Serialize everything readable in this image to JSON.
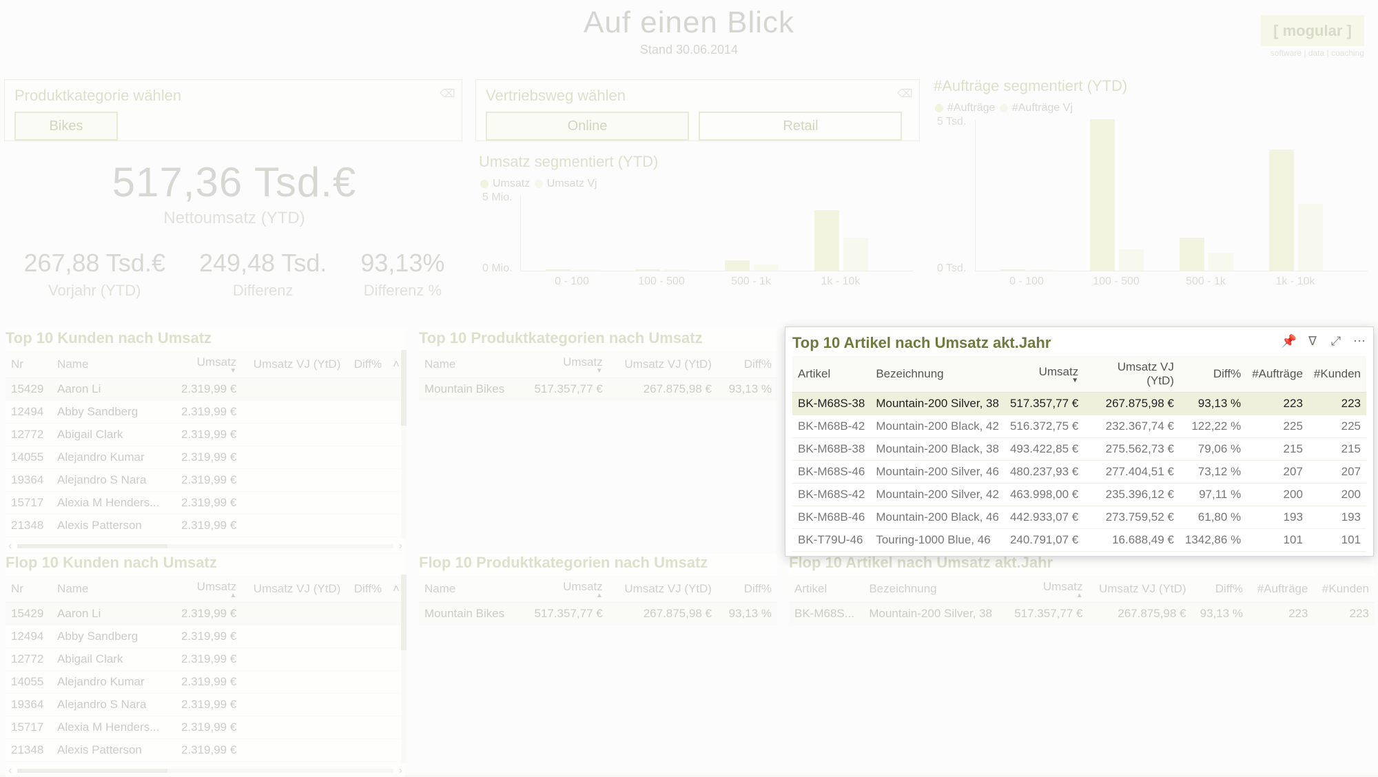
{
  "header": {
    "title": "Auf einen Blick",
    "subtitle": "Stand 30.06.2014"
  },
  "logo": {
    "text": "[ mogular ]",
    "sub": "software | data | coaching"
  },
  "slicer_category": {
    "title": "Produktkategorie wählen",
    "option": "Bikes"
  },
  "slicer_channel": {
    "title": "Vertriebsweg wählen",
    "option1": "Online",
    "option2": "Retail"
  },
  "kpi": {
    "main_value": "517,36 Tsd.€",
    "main_label": "Nettoumsatz (YTD)",
    "prev_value": "267,88 Tsd.€",
    "prev_label": "Vorjahr (YTD)",
    "diff_value": "249,48 Tsd.",
    "diff_label": "Differenz",
    "diffp_value": "93,13%",
    "diffp_label": "Differenz %"
  },
  "chart_umsatz": {
    "title": "Umsatz segmentiert (YTD)",
    "legend1": "Umsatz",
    "legend2": "Umsatz Vj",
    "ylab_top": "5 Mio.",
    "ylab_bot": "0 Mio."
  },
  "chart_auftraege": {
    "title": "#Aufträge segmentiert (YTD)",
    "legend1": "#Aufträge",
    "legend2": "#Aufträge Vj",
    "ylab_top": "5 Tsd.",
    "ylab_bot": "0 Tsd."
  },
  "chart_categories": {
    "c1": "0 - 100",
    "c2": "100 - 500",
    "c3": "500 - 1k",
    "c4": "1k - 10k"
  },
  "chart_data": [
    {
      "type": "bar",
      "title": "Umsatz segmentiert (YTD)",
      "categories": [
        "0 - 100",
        "100 - 500",
        "500 - 1k",
        "1k - 10k"
      ],
      "series": [
        {
          "name": "Umsatz",
          "values": [
            0.05,
            0.05,
            0.7,
            4.0
          ]
        },
        {
          "name": "Umsatz Vj",
          "values": [
            0.05,
            0.05,
            0.4,
            2.2
          ]
        }
      ],
      "ylabel": "Mio.",
      "ylim": [
        0,
        5
      ]
    },
    {
      "type": "bar",
      "title": "#Aufträge segmentiert (YTD)",
      "categories": [
        "0 - 100",
        "100 - 500",
        "500 - 1k",
        "1k - 10k"
      ],
      "series": [
        {
          "name": "#Aufträge",
          "values": [
            0.05,
            5.0,
            1.1,
            4.0
          ]
        },
        {
          "name": "#Aufträge Vj",
          "values": [
            0.05,
            0.7,
            0.6,
            2.2
          ]
        }
      ],
      "ylabel": "Tsd.",
      "ylim": [
        0,
        5
      ]
    }
  ],
  "table_top_customers": {
    "title": "Top 10 Kunden nach Umsatz",
    "cols": {
      "nr": "Nr",
      "name": "Name",
      "umsatz": "Umsatz",
      "umsatz_vj": "Umsatz VJ (YtD)",
      "diff": "Diff%"
    },
    "rows": [
      {
        "nr": "15429",
        "name": "Aaron Li",
        "umsatz": "2.319,99 €"
      },
      {
        "nr": "12494",
        "name": "Abby Sandberg",
        "umsatz": "2.319,99 €"
      },
      {
        "nr": "12772",
        "name": "Abigail Clark",
        "umsatz": "2.319,99 €"
      },
      {
        "nr": "14055",
        "name": "Alejandro Kumar",
        "umsatz": "2.319,99 €"
      },
      {
        "nr": "19364",
        "name": "Alejandro S Nara",
        "umsatz": "2.319,99 €"
      },
      {
        "nr": "15717",
        "name": "Alexia M Henders...",
        "umsatz": "2.319,99 €"
      },
      {
        "nr": "21348",
        "name": "Alexis Patterson",
        "umsatz": "2.319,99 €"
      }
    ]
  },
  "table_flop_customers": {
    "title": "Flop 10 Kunden nach Umsatz"
  },
  "table_top_cat": {
    "title": "Top 10 Produktkategorien nach Umsatz",
    "cols": {
      "name": "Name",
      "umsatz": "Umsatz",
      "umsatz_vj": "Umsatz VJ (YtD)",
      "diff": "Diff%"
    },
    "row": {
      "name": "Mountain Bikes",
      "umsatz": "517.357,77 €",
      "umsatz_vj": "267.875,98 €",
      "diff": "93,13 %"
    }
  },
  "table_flop_cat": {
    "title": "Flop 10 Produktkategorien nach Umsatz"
  },
  "table_top_articles": {
    "title": "Top 10 Artikel nach Umsatz akt.Jahr",
    "cols": {
      "artikel": "Artikel",
      "bez": "Bezeichnung",
      "umsatz": "Umsatz",
      "umsatz_vj": "Umsatz VJ (YtD)",
      "diff": "Diff%",
      "auftraege": "#Aufträge",
      "kunden": "#Kunden"
    },
    "rows": [
      {
        "artikel": "BK-M68S-38",
        "bez": "Mountain-200 Silver, 38",
        "umsatz": "517.357,77 €",
        "umsatz_vj": "267.875,98 €",
        "diff": "93,13 %",
        "auftraege": "223",
        "kunden": "223"
      },
      {
        "artikel": "BK-M68B-42",
        "bez": "Mountain-200 Black, 42",
        "umsatz": "516.372,75 €",
        "umsatz_vj": "232.367,74 €",
        "diff": "122,22 %",
        "auftraege": "225",
        "kunden": "225"
      },
      {
        "artikel": "BK-M68B-38",
        "bez": "Mountain-200 Black, 38",
        "umsatz": "493.422,85 €",
        "umsatz_vj": "275.562,73 €",
        "diff": "79,06 %",
        "auftraege": "215",
        "kunden": "215"
      },
      {
        "artikel": "BK-M68S-46",
        "bez": "Mountain-200 Silver, 46",
        "umsatz": "480.237,93 €",
        "umsatz_vj": "277.404,51 €",
        "diff": "73,12 %",
        "auftraege": "207",
        "kunden": "207"
      },
      {
        "artikel": "BK-M68S-42",
        "bez": "Mountain-200 Silver, 42",
        "umsatz": "463.998,00 €",
        "umsatz_vj": "235.396,12 €",
        "diff": "97,11 %",
        "auftraege": "200",
        "kunden": "200"
      },
      {
        "artikel": "BK-M68B-46",
        "bez": "Mountain-200 Black, 46",
        "umsatz": "442.933,07 €",
        "umsatz_vj": "273.759,52 €",
        "diff": "61,80 %",
        "auftraege": "193",
        "kunden": "193"
      },
      {
        "artikel": "BK-T79U-46",
        "bez": "Touring-1000 Blue, 46",
        "umsatz": "240.791,07 €",
        "umsatz_vj": "16.688,49 €",
        "diff": "1342,86 %",
        "auftraege": "101",
        "kunden": "101"
      }
    ]
  },
  "table_flop_articles": {
    "title": "Flop 10 Artikel nach Umsatz akt.Jahr",
    "row": {
      "artikel": "BK-M68S...",
      "bez": "Mountain-200 Silver, 38",
      "umsatz": "517.357,77 €",
      "umsatz_vj": "267.875,98 €",
      "diff": "93,13 %",
      "auftraege": "223",
      "kunden": "223"
    }
  }
}
